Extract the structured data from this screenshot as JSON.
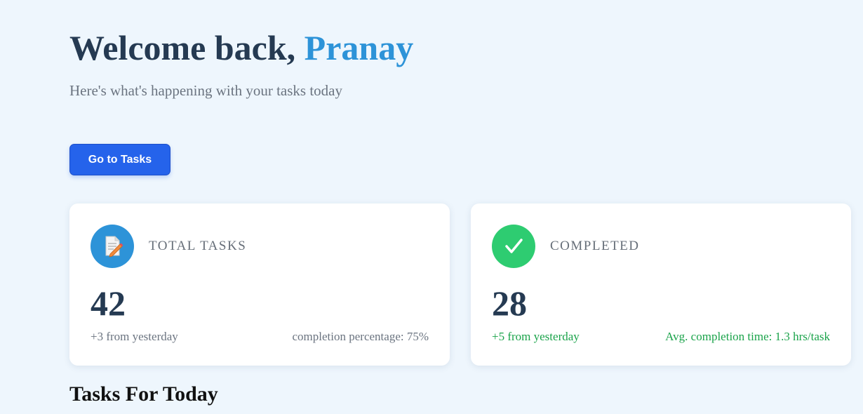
{
  "header": {
    "greeting": "Welcome back,",
    "user_name": "Pranay",
    "subtitle": "Here's what's happening with your tasks today"
  },
  "actions": {
    "go_to_tasks_label": "Go to Tasks"
  },
  "stats": {
    "total": {
      "label": "TOTAL TASKS",
      "value": "42",
      "change": "+3 from yesterday",
      "extra": "completion percentage: 75%",
      "icon": "task-document-icon",
      "icon_color": "#2d93d8"
    },
    "completed": {
      "label": "COMPLETED",
      "value": "28",
      "change": "+5 from yesterday",
      "extra": "Avg. completion time: 1.3 hrs/task",
      "icon": "checkmark-icon",
      "icon_color": "#2ecc71",
      "text_color": "#1aa34a"
    }
  },
  "sections": {
    "today_title": "Tasks For Today"
  },
  "colors": {
    "background": "#eef6fd",
    "accent_blue": "#2563eb",
    "name_blue": "#2d93d8",
    "heading": "#253a52"
  }
}
